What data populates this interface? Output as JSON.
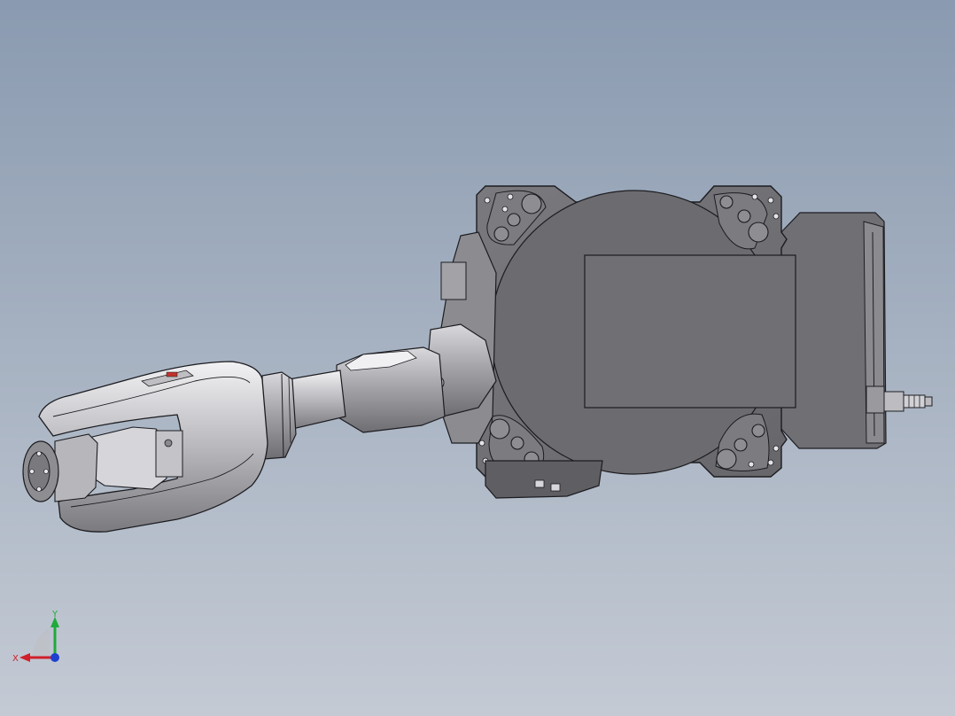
{
  "viewport": {
    "background_top": "#8a9ab0",
    "background_bottom": "#c4cad4"
  },
  "model": {
    "body_color": "#6f6f73",
    "arm_color": "#9a9a9e",
    "highlight_color": "#e8e8ec",
    "accent_color": "#c0342c"
  },
  "triad": {
    "x_label": "X",
    "y_label": "Y",
    "x_color": "#d0202a",
    "y_color": "#1faa3a",
    "z_color": "#1f3fd0"
  }
}
